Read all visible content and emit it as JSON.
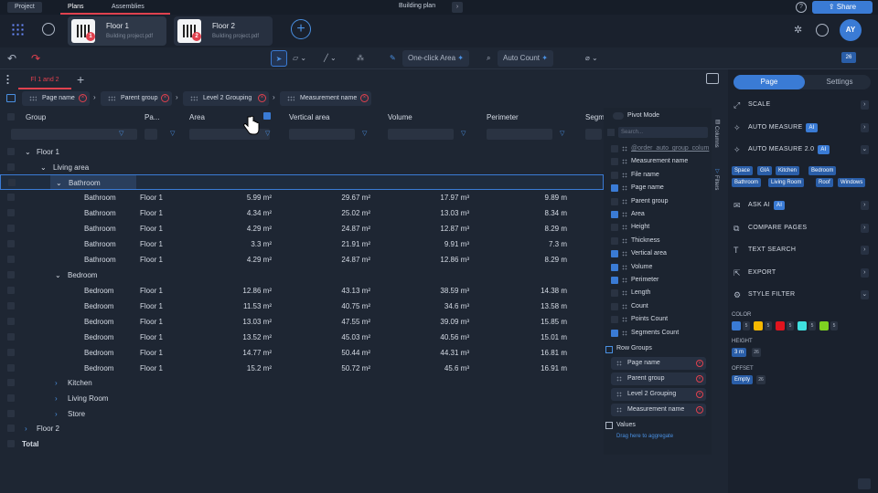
{
  "topbar": {
    "project": "Project",
    "plans": "Plans",
    "assemblies": "Assemblies",
    "title": "Building plan",
    "share": "Share"
  },
  "plans": [
    {
      "title": "Floor 1",
      "file": "Building project.pdf",
      "badge": "1"
    },
    {
      "title": "Floor 2",
      "file": "Building project.pdf",
      "badge": "2"
    }
  ],
  "user": {
    "initials": "AY"
  },
  "toolbar": {
    "one_click": "One-click Area",
    "auto_count": "Auto Count",
    "page_count": "26"
  },
  "view": {
    "tab": "Fl 1 and 2"
  },
  "groups": [
    "Page name",
    "Parent group",
    "Level 2 Grouping",
    "Measurement name"
  ],
  "columns": {
    "group": "Group",
    "pa": "Pa...",
    "area": "Area",
    "vertical_area": "Vertical area",
    "volume": "Volume",
    "perimeter": "Perimeter",
    "segm": "Segm"
  },
  "tree": {
    "floor1": "Floor 1",
    "living": "Living area",
    "bathroom": "Bathroom",
    "bedroom": "Bedroom",
    "kitchen": "Kitchen",
    "living_room": "Living Room",
    "store": "Store",
    "floor2": "Floor 2",
    "total": "Total"
  },
  "rows": [
    {
      "name": "Bathroom",
      "page": "Floor 1",
      "area": "5.99 m²",
      "varea": "29.67 m²",
      "volume": "17.97 m³",
      "perimeter": "9.89 m"
    },
    {
      "name": "Bathroom",
      "page": "Floor 1",
      "area": "4.34 m²",
      "varea": "25.02 m²",
      "volume": "13.03 m³",
      "perimeter": "8.34 m"
    },
    {
      "name": "Bathroom",
      "page": "Floor 1",
      "area": "4.29 m²",
      "varea": "24.87 m²",
      "volume": "12.87 m³",
      "perimeter": "8.29 m"
    },
    {
      "name": "Bathroom",
      "page": "Floor 1",
      "area": "3.3 m²",
      "varea": "21.91 m²",
      "volume": "9.91 m³",
      "perimeter": "7.3 m"
    },
    {
      "name": "Bathroom",
      "page": "Floor 1",
      "area": "4.29 m²",
      "varea": "24.87 m²",
      "volume": "12.86 m³",
      "perimeter": "8.29 m"
    },
    {
      "name": "Bedroom",
      "page": "Floor 1",
      "area": "12.86 m²",
      "varea": "43.13 m²",
      "volume": "38.59 m³",
      "perimeter": "14.38 m"
    },
    {
      "name": "Bedroom",
      "page": "Floor 1",
      "area": "11.53 m²",
      "varea": "40.75 m²",
      "volume": "34.6 m³",
      "perimeter": "13.58 m"
    },
    {
      "name": "Bedroom",
      "page": "Floor 1",
      "area": "13.03 m²",
      "varea": "47.55 m²",
      "volume": "39.09 m³",
      "perimeter": "15.85 m"
    },
    {
      "name": "Bedroom",
      "page": "Floor 1",
      "area": "13.52 m²",
      "varea": "45.03 m²",
      "volume": "40.56 m³",
      "perimeter": "15.01 m"
    },
    {
      "name": "Bedroom",
      "page": "Floor 1",
      "area": "14.77 m²",
      "varea": "50.44 m²",
      "volume": "44.31 m³",
      "perimeter": "16.81 m"
    },
    {
      "name": "Bedroom",
      "page": "Floor 1",
      "area": "15.2 m²",
      "varea": "50.72 m²",
      "volume": "45.6 m³",
      "perimeter": "16.91 m"
    }
  ],
  "colpanel": {
    "pivot": "Pivot Mode",
    "search": "Search...",
    "items": [
      {
        "label": "@order_auto_group_colum",
        "on": false
      },
      {
        "label": "Measurement name",
        "on": false
      },
      {
        "label": "File name",
        "on": false
      },
      {
        "label": "Page name",
        "on": true
      },
      {
        "label": "Parent group",
        "on": false
      },
      {
        "label": "Area",
        "on": true
      },
      {
        "label": "Height",
        "on": false
      },
      {
        "label": "Thickness",
        "on": false
      },
      {
        "label": "Vertical area",
        "on": true
      },
      {
        "label": "Volume",
        "on": true
      },
      {
        "label": "Perimeter",
        "on": true
      },
      {
        "label": "Length",
        "on": false
      },
      {
        "label": "Count",
        "on": false
      },
      {
        "label": "Points Count",
        "on": false
      },
      {
        "label": "Segments Count",
        "on": true
      }
    ],
    "row_groups": "Row Groups",
    "rg_items": [
      "Page name",
      "Parent group",
      "Level 2 Grouping",
      "Measurement name"
    ],
    "values": "Values",
    "drag_hint": "Drag here to aggregate",
    "columns_tab": "Columns",
    "filters_tab": "Filters"
  },
  "right": {
    "page": "Page",
    "settings": "Settings",
    "scale": "SCALE",
    "auto_measure": "AUTO MEASURE",
    "auto_measure2": "AUTO MEASURE 2.0",
    "ai": "AI",
    "tags": [
      "Space",
      "GIA",
      "Kitchen",
      "Bedroom",
      "Bathroom",
      "Living Room",
      "Roof",
      "Windows"
    ],
    "ask_ai": "ASK AI",
    "compare": "COMPARE PAGES",
    "text_search": "TEXT SEARCH",
    "export": "EXPORT",
    "style_filter": "STYLE FILTER",
    "color_label": "COLOR",
    "colors": [
      {
        "hex": "#3a7bd5",
        "n": "5"
      },
      {
        "hex": "#f5b800",
        "n": "5"
      },
      {
        "hex": "#e0141e",
        "n": "5"
      },
      {
        "hex": "#3fe0e0",
        "n": "5"
      },
      {
        "hex": "#7ed321",
        "n": "5"
      }
    ],
    "height_label": "HEIGHT",
    "height_val": "3 m",
    "height_n": "26",
    "offset_label": "OFFSET",
    "offset_val": "Empty",
    "offset_n": "26"
  }
}
